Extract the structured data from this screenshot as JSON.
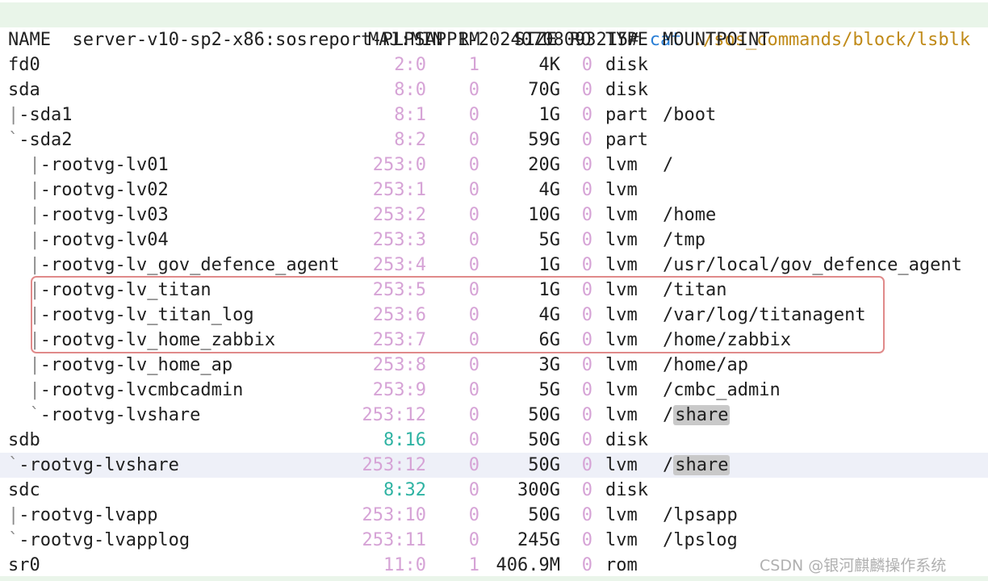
{
  "prompt": {
    "host": "server-v10-sp2-x86:sosreport-PLPSAPP1-20240708093215#",
    "command": "cat",
    "argument": "./sos_commands/block/lsblk"
  },
  "header": {
    "name": "NAME",
    "majmin": "MAJ:MIN",
    "rm": "RM",
    "size": "SIZE",
    "ro": "RO",
    "type": "TYPE",
    "mountpoint": "MOUNTPOINT"
  },
  "rows": [
    {
      "name": "fd0",
      "majmin": "2:0",
      "rm": "1",
      "size": "4K",
      "ro": "0",
      "type": "disk",
      "mountpoint": ""
    },
    {
      "name": "sda",
      "majmin": "8:0",
      "rm": "0",
      "size": "70G",
      "ro": "0",
      "type": "disk",
      "mountpoint": ""
    },
    {
      "name": "|-sda1",
      "majmin": "8:1",
      "rm": "0",
      "size": "1G",
      "ro": "0",
      "type": "part",
      "mountpoint": "/boot"
    },
    {
      "name": "`-sda2",
      "majmin": "8:2",
      "rm": "0",
      "size": "59G",
      "ro": "0",
      "type": "part",
      "mountpoint": ""
    },
    {
      "name": "  |-rootvg-lv01",
      "majmin": "253:0",
      "rm": "0",
      "size": "20G",
      "ro": "0",
      "type": "lvm",
      "mountpoint": "/"
    },
    {
      "name": "  |-rootvg-lv02",
      "majmin": "253:1",
      "rm": "0",
      "size": "4G",
      "ro": "0",
      "type": "lvm",
      "mountpoint": ""
    },
    {
      "name": "  |-rootvg-lv03",
      "majmin": "253:2",
      "rm": "0",
      "size": "10G",
      "ro": "0",
      "type": "lvm",
      "mountpoint": "/home"
    },
    {
      "name": "  |-rootvg-lv04",
      "majmin": "253:3",
      "rm": "0",
      "size": "5G",
      "ro": "0",
      "type": "lvm",
      "mountpoint": "/tmp"
    },
    {
      "name": "  |-rootvg-lv_gov_defence_agent",
      "majmin": "253:4",
      "rm": "0",
      "size": "1G",
      "ro": "0",
      "type": "lvm",
      "mountpoint": "/usr/local/gov_defence_agent"
    },
    {
      "name": "  |-rootvg-lv_titan",
      "majmin": "253:5",
      "rm": "0",
      "size": "1G",
      "ro": "0",
      "type": "lvm",
      "mountpoint": "/titan"
    },
    {
      "name": "  |-rootvg-lv_titan_log",
      "majmin": "253:6",
      "rm": "0",
      "size": "4G",
      "ro": "0",
      "type": "lvm",
      "mountpoint": "/var/log/titanagent"
    },
    {
      "name": "  |-rootvg-lv_home_zabbix",
      "majmin": "253:7",
      "rm": "0",
      "size": "6G",
      "ro": "0",
      "type": "lvm",
      "mountpoint": "/home/zabbix"
    },
    {
      "name": "  |-rootvg-lv_home_ap",
      "majmin": "253:8",
      "rm": "0",
      "size": "3G",
      "ro": "0",
      "type": "lvm",
      "mountpoint": "/home/ap"
    },
    {
      "name": "  |-rootvg-lvcmbcadmin",
      "majmin": "253:9",
      "rm": "0",
      "size": "5G",
      "ro": "0",
      "type": "lvm",
      "mountpoint": "/cmbc_admin"
    },
    {
      "name": "  `-rootvg-lvshare",
      "majmin": "253:12",
      "rm": "0",
      "size": "50G",
      "ro": "0",
      "type": "lvm",
      "mountpoint": "/share"
    },
    {
      "name": "sdb",
      "majmin": "8:16",
      "rm": "0",
      "size": "50G",
      "ro": "0",
      "type": "disk",
      "mountpoint": ""
    },
    {
      "name": "`-rootvg-lvshare",
      "majmin": "253:12",
      "rm": "0",
      "size": "50G",
      "ro": "0",
      "type": "lvm",
      "mountpoint": "/share"
    },
    {
      "name": "sdc",
      "majmin": "8:32",
      "rm": "0",
      "size": "300G",
      "ro": "0",
      "type": "disk",
      "mountpoint": ""
    },
    {
      "name": "|-rootvg-lvapp",
      "majmin": "253:10",
      "rm": "0",
      "size": "50G",
      "ro": "0",
      "type": "lvm",
      "mountpoint": "/lpsapp"
    },
    {
      "name": "`-rootvg-lvapplog",
      "majmin": "253:11",
      "rm": "0",
      "size": "245G",
      "ro": "0",
      "type": "lvm",
      "mountpoint": "/lpslog"
    },
    {
      "name": "sr0",
      "majmin": "11:0",
      "rm": "1",
      "size": "406.9M",
      "ro": "0",
      "type": "rom",
      "mountpoint": ""
    }
  ],
  "watermark": "CSDN @银河麒麟操作系统",
  "colors": {
    "prompt_bg": "#e9f5e9",
    "command": "#2a7fd6",
    "argument": "#c08a18",
    "muted_number": "#d6a3d6",
    "disk_major": "#2fb3a3",
    "highlight_box": "#e08a8a",
    "highlight_row": "#eef0f8"
  }
}
